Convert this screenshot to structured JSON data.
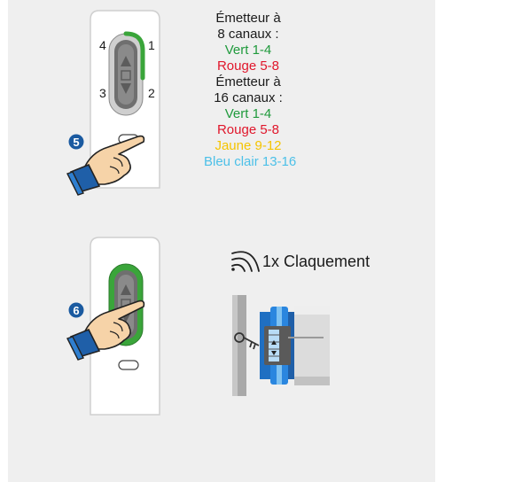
{
  "channels": {
    "title_8_line1": "Émetteur à",
    "title_8_line2": "8 canaux :",
    "green": "Vert 1-4",
    "red": "Rouge 5-8",
    "title_16_line1": "Émetteur à",
    "title_16_line2": "16 canaux :",
    "green_16": "Vert 1-4",
    "red_16": "Rouge 5-8",
    "yellow": "Jaune 9-12",
    "lightblue": "Bleu clair 13-16"
  },
  "step5": {
    "number": "5",
    "corner_labels": [
      "4",
      "1",
      "3",
      "2"
    ]
  },
  "step6": {
    "number": "6",
    "click_text": "1x Claquement"
  },
  "colors": {
    "panel": "#efefef",
    "green": "#1f9a3c",
    "red": "#e0162b",
    "yellow": "#f5c400",
    "lightblue": "#4cc0e8",
    "step_badge": "#1a5aa0",
    "led_green": "#3aa53a"
  },
  "icons": [
    "hand-pointer-icon",
    "sound-waves-icon",
    "lock-cylinder-icon",
    "key-icon",
    "up-arrow-icon",
    "down-arrow-icon",
    "stop-square-icon"
  ]
}
